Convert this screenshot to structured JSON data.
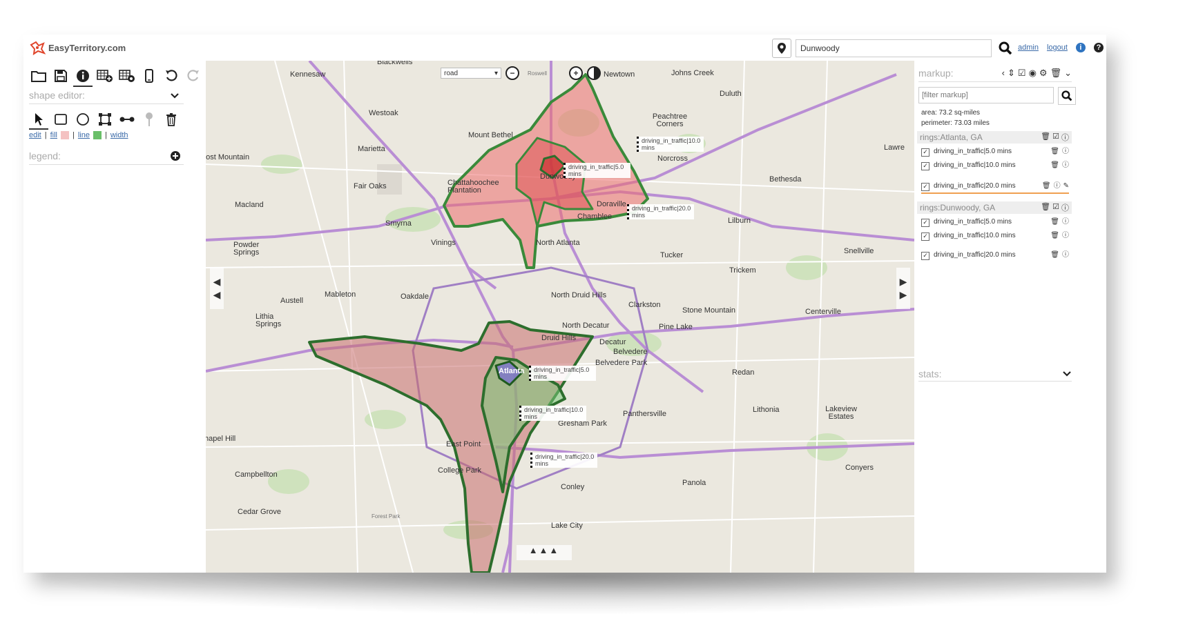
{
  "app": {
    "logo_text": "EasyTerritory.com"
  },
  "search": {
    "value": "Dunwoody"
  },
  "top_links": {
    "admin": "admin",
    "logout": "logout"
  },
  "left_panel": {
    "shape_editor_title": "shape editor:",
    "legend_title": "legend:",
    "style": {
      "edit": "edit",
      "fill": "fill",
      "line": "line",
      "width": "width",
      "fill_color": "#f4c2c2",
      "line_color": "#6abf69"
    }
  },
  "map": {
    "map_type": "road",
    "labels": [
      "Kennesaw",
      "Blackwells",
      "Westoak",
      "Marietta",
      "Mount Bethel",
      "Chattahoochee Plantation",
      "Fair Oaks",
      "Macland",
      "Smyrna",
      "Powder Springs",
      "Vinings",
      "Mableton",
      "Oakdale",
      "Austell",
      "Lithia Springs",
      "Johns Creek",
      "Newtown",
      "Duluth",
      "Peachtree Corners",
      "Norcross",
      "Dunwoody",
      "Doraville",
      "Chamblee",
      "North Atlanta",
      "Tucker",
      "Lilburn",
      "Bethesda",
      "Snellville",
      "Trickem",
      "North Druid Hills",
      "Clarkston",
      "Stone Mountain",
      "Centerville",
      "North Decatur",
      "Druid Hills",
      "Decatur",
      "Pine Lake",
      "Belvedere",
      "Belvedere Park",
      "Atlanta",
      "Redan",
      "East Point",
      "Panthersville",
      "Gresham Park",
      "Lithonia",
      "Lakeview Estates",
      "College Park",
      "Campbellton",
      "Cedar Grove",
      "Conley",
      "Forest Park",
      "Panola",
      "Conyers",
      "Lost Mountain",
      "hapel Hill",
      "Roswell",
      "Lawre",
      "Lake City"
    ],
    "callouts": [
      "driving_in_traffic|10.0 mins",
      "driving_in_traffic|5.0 mins",
      "driving_in_traffic|20.0 mins",
      "driving_in_traffic|5.0 mins",
      "driving_in_traffic|10.0 mins",
      "driving_in_traffic|20.0 mins"
    ]
  },
  "right_panel": {
    "markup_title": "markup:",
    "filter_placeholder": "[filter markup]",
    "area": "area: 73.2 sq-miles",
    "perimeter": "perimeter: 73.03 miles",
    "groups": [
      {
        "title": "rings:Atlanta, GA",
        "items": [
          "driving_in_traffic|5.0 mins",
          "driving_in_traffic|10.0 mins",
          "driving_in_traffic|20.0 mins"
        ]
      },
      {
        "title": "rings:Dunwoody, GA",
        "items": [
          "driving_in_traffic|5.0 mins",
          "driving_in_traffic|10.0 mins",
          "driving_in_traffic|20.0 mins"
        ]
      }
    ],
    "stats_title": "stats:"
  }
}
